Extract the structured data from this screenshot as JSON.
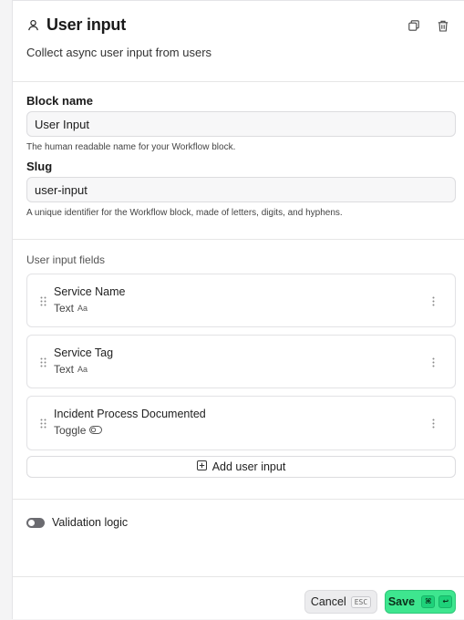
{
  "header": {
    "title": "User input",
    "subtitle": "Collect async user input from users",
    "title_icon": "person-icon",
    "actions": [
      "duplicate-icon",
      "trash-icon"
    ]
  },
  "block_name": {
    "label": "Block name",
    "value": "User Input",
    "help": "The human readable name for your Workflow block."
  },
  "slug": {
    "label": "Slug",
    "value": "user-input",
    "help": "A unique identifier for the Workflow block, made of letters, digits, and hyphens."
  },
  "user_input_fields": {
    "heading": "User input fields",
    "items": [
      {
        "name": "Service Name",
        "type": "Text",
        "type_icon": "Aa"
      },
      {
        "name": "Service Tag",
        "type": "Text",
        "type_icon": "Aa"
      },
      {
        "name": "Incident Process Documented",
        "type": "Toggle",
        "type_icon": "toggle-icon"
      }
    ],
    "add_label": "Add user input"
  },
  "validation": {
    "label": "Validation logic",
    "enabled": false
  },
  "footer": {
    "cancel_label": "Cancel",
    "cancel_kbd": "ESC",
    "save_label": "Save",
    "save_kbd_1": "⌘",
    "save_kbd_2": "↩"
  },
  "colors": {
    "accent": "#3ee68f",
    "toggle_off": "#6b6b70"
  }
}
